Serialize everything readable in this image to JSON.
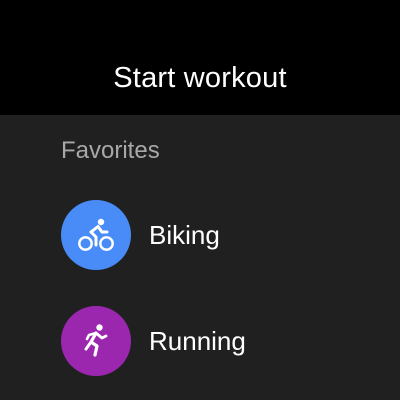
{
  "header": {
    "title": "Start workout"
  },
  "favorites": {
    "label": "Favorites",
    "items": [
      {
        "label": "Biking",
        "icon": "biking-icon",
        "color": "#4a8cf7"
      },
      {
        "label": "Running",
        "icon": "running-icon",
        "color": "#9b27af"
      }
    ]
  },
  "colors": {
    "header_bg": "#000000",
    "screen_bg": "#202020",
    "section_label": "#a8a8a8"
  }
}
